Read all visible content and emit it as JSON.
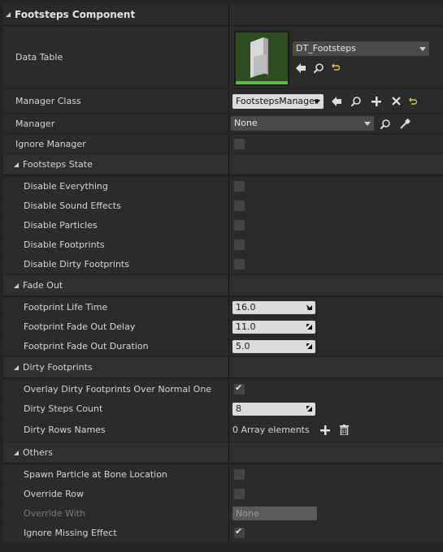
{
  "component_header": "Footsteps Component",
  "data_table": {
    "label": "Data Table",
    "asset_name": "DT_Footsteps"
  },
  "manager_class": {
    "label": "Manager Class",
    "value": "FootstepsManager"
  },
  "manager": {
    "label": "Manager",
    "value": "None"
  },
  "ignore_manager": {
    "label": "Ignore Manager",
    "checked": false
  },
  "sections": {
    "footsteps_state": "Footsteps State",
    "fade_out": "Fade Out",
    "dirty_footprints": "Dirty Footprints",
    "others": "Others"
  },
  "footsteps_state": [
    {
      "label": "Disable Everything",
      "checked": false
    },
    {
      "label": "Disable Sound Effects",
      "checked": false
    },
    {
      "label": "Disable Particles",
      "checked": false
    },
    {
      "label": "Disable Footprints",
      "checked": false
    },
    {
      "label": "Disable Dirty Footprints",
      "checked": false
    }
  ],
  "fade_out": [
    {
      "label": "Footprint Life Time",
      "value": "16.0"
    },
    {
      "label": "Footprint Fade Out Delay",
      "value": "11.0"
    },
    {
      "label": "Footprint Fade Out Duration",
      "value": "5.0"
    }
  ],
  "dirty": {
    "overlay_label": "Overlay Dirty Footprints Over Normal One",
    "overlay_checked": true,
    "steps_label": "Dirty Steps Count",
    "steps_value": "8",
    "rows_label": "Dirty Rows Names",
    "rows_value": "0 Array elements"
  },
  "others": {
    "spawn_label": "Spawn Particle at Bone Location",
    "spawn_checked": false,
    "override_row_label": "Override Row",
    "override_row_checked": false,
    "override_with_label": "Override With",
    "override_with_value": "None",
    "ignore_missing_label": "Ignore Missing Effect",
    "ignore_missing_checked": true
  },
  "colors": {
    "panel": "#242424",
    "row": "#2b2b2b",
    "header": "#2f2f2f",
    "asset_thumb_bg": "#3a5a2a",
    "asset_thumb_bar": "#5cba3c",
    "reset_arrow": "#d8c34a"
  },
  "icons": [
    "collapse-triangle-icon",
    "use-selected-arrow-icon",
    "browse-magnifier-icon",
    "reset-to-default-icon",
    "add-plus-icon",
    "clear-x-icon",
    "pick-actor-eyedropper-icon",
    "trash-icon",
    "dropdown-arrow-icon"
  ]
}
